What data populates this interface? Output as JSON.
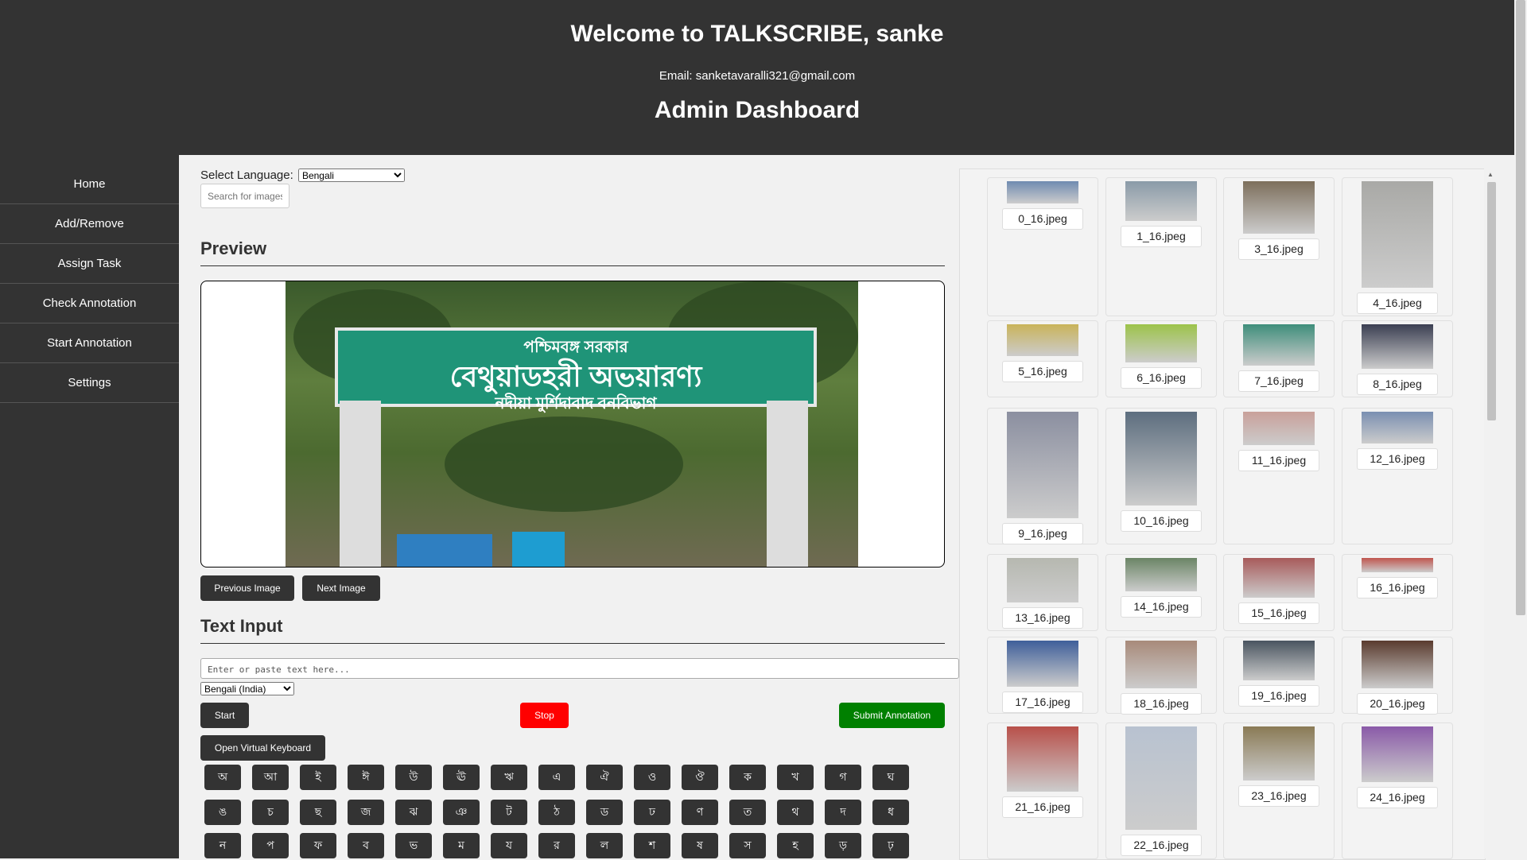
{
  "header": {
    "welcome": "Welcome to TALKSCRIBE, sanke",
    "email": "Email: sanketavaralli321@gmail.com",
    "dashboard": "Admin Dashboard"
  },
  "sidebar": {
    "items": [
      {
        "label": "Home"
      },
      {
        "label": "Add/Remove"
      },
      {
        "label": "Assign Task"
      },
      {
        "label": "Check Annotation"
      },
      {
        "label": "Start Annotation"
      },
      {
        "label": "Settings"
      }
    ]
  },
  "main": {
    "language_label": "Select Language:",
    "language_selected": "Bengali",
    "search_placeholder": "Search for images",
    "preview_title": "Preview",
    "preview_sign": {
      "line1": "পশ্চিমবঙ্গ   সরকার",
      "line2": "বেথুয়াডহরী  অভয়ারণ্য",
      "line3": "নদীয়া মুর্শিদাবাদ বনবিভাগ"
    },
    "prev_button": "Previous Image",
    "next_button": "Next Image",
    "text_input_title": "Text Input",
    "textarea_placeholder": "Enter or paste text here...",
    "locale_selected": "Bengali (India)",
    "start_button": "Start",
    "stop_button": "Stop",
    "submit_button": "Submit Annotation",
    "keyboard_button": "Open Virtual Keyboard",
    "stop_color": "#ff0000",
    "submit_color": "#008000"
  },
  "keyboard": {
    "row1": [
      "অ",
      "আ",
      "ই",
      "ঈ",
      "উ",
      "ঊ",
      "ঋ",
      "এ",
      "ঐ",
      "ও",
      "ঔ",
      "ক",
      "খ",
      "গ",
      "ঘ"
    ],
    "row2": [
      "ঙ",
      "চ",
      "ছ",
      "জ",
      "ঝ",
      "ঞ",
      "ট",
      "ঠ",
      "ড",
      "ঢ",
      "ণ",
      "ত",
      "থ",
      "দ",
      "ধ"
    ],
    "row3": [
      "ন",
      "প",
      "ফ",
      "ব",
      "ভ",
      "ম",
      "য",
      "র",
      "ল",
      "শ",
      "ষ",
      "স",
      "হ",
      "ড়",
      "ঢ়"
    ]
  },
  "gallery": {
    "images": [
      {
        "name": "0_16.jpeg",
        "color": "#6f8bb0"
      },
      {
        "name": "1_16.jpeg",
        "color": "#8a9aa8"
      },
      {
        "name": "3_16.jpeg",
        "color": "#7d6f5c"
      },
      {
        "name": "4_16.jpeg",
        "color": "#a9a9a6"
      },
      {
        "name": "5_16.jpeg",
        "color": "#c9b35a"
      },
      {
        "name": "6_16.jpeg",
        "color": "#9cc34a"
      },
      {
        "name": "7_16.jpeg",
        "color": "#3f8e7b"
      },
      {
        "name": "8_16.jpeg",
        "color": "#3b3f52"
      },
      {
        "name": "9_16.jpeg",
        "color": "#8b8fa0"
      },
      {
        "name": "10_16.jpeg",
        "color": "#5d6e7f"
      },
      {
        "name": "11_16.jpeg",
        "color": "#c9a09a"
      },
      {
        "name": "12_16.jpeg",
        "color": "#7a8fb1"
      },
      {
        "name": "13_16.jpeg",
        "color": "#b6b8b0"
      },
      {
        "name": "14_16.jpeg",
        "color": "#6b8566"
      },
      {
        "name": "15_16.jpeg",
        "color": "#a85b5b"
      },
      {
        "name": "16_16.jpeg",
        "color": "#c0564f"
      },
      {
        "name": "17_16.jpeg",
        "color": "#3f5f9a"
      },
      {
        "name": "18_16.jpeg",
        "color": "#a88a7a"
      },
      {
        "name": "19_16.jpeg",
        "color": "#4a5560"
      },
      {
        "name": "20_16.jpeg",
        "color": "#5a3b2e"
      },
      {
        "name": "21_16.jpeg",
        "color": "#b8504a"
      },
      {
        "name": "22_16.jpeg",
        "color": "#b8c2d0"
      },
      {
        "name": "23_16.jpeg",
        "color": "#8a7a55"
      },
      {
        "name": "24_16.jpeg",
        "color": "#8a5aa8"
      }
    ]
  }
}
